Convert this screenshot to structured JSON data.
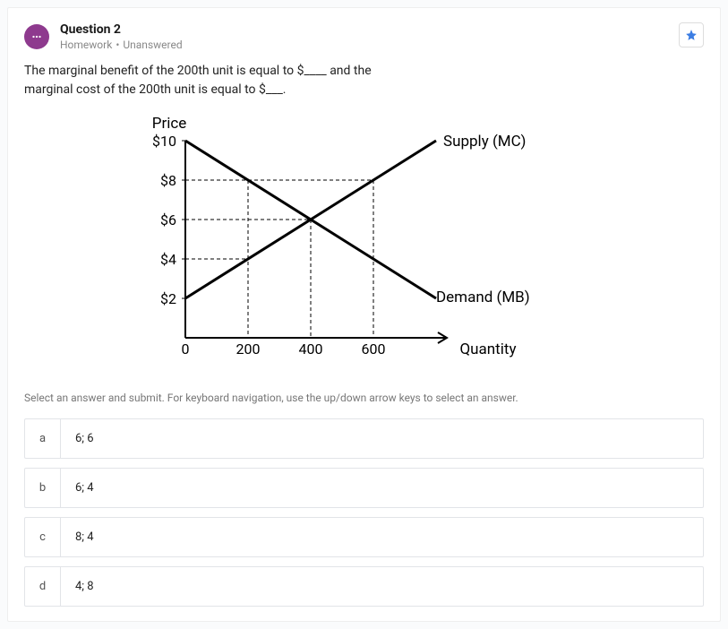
{
  "header": {
    "title": "Question 2",
    "category": "Homework",
    "status": "Unanswered"
  },
  "question": {
    "line1": "The marginal benefit of the 200th unit is equal to $____ and the",
    "line2": "marginal cost of the 200th unit is equal to $___."
  },
  "chart_data": {
    "type": "line",
    "title": "",
    "xlabel": "Quantity",
    "ylabel": "Price",
    "xlim": [
      0,
      800
    ],
    "ylim": [
      0,
      10
    ],
    "x_ticks": [
      0,
      200,
      400,
      600
    ],
    "y_ticks": [
      2,
      4,
      6,
      8,
      10
    ],
    "y_tick_labels": [
      "$2",
      "$4",
      "$6",
      "$8",
      "$10"
    ],
    "series": [
      {
        "name": "Supply (MC)",
        "x": [
          0,
          800
        ],
        "y": [
          2,
          10
        ]
      },
      {
        "name": "Demand (MB)",
        "x": [
          0,
          800
        ],
        "y": [
          10,
          2
        ]
      }
    ],
    "guides": [
      {
        "x": 200,
        "y": 8
      },
      {
        "x": 200,
        "y": 4
      },
      {
        "x": 400,
        "y": 6
      },
      {
        "x": 600,
        "y": 8
      }
    ],
    "labels": {
      "supply": "Supply (MC)",
      "demand": "Demand (MB)"
    }
  },
  "instructions": "Select an answer and submit. For keyboard navigation, use the up/down arrow keys to select an answer.",
  "options": [
    {
      "key": "a",
      "text": "6; 6"
    },
    {
      "key": "b",
      "text": "6; 4"
    },
    {
      "key": "c",
      "text": "8; 4"
    },
    {
      "key": "d",
      "text": "4; 8"
    }
  ]
}
